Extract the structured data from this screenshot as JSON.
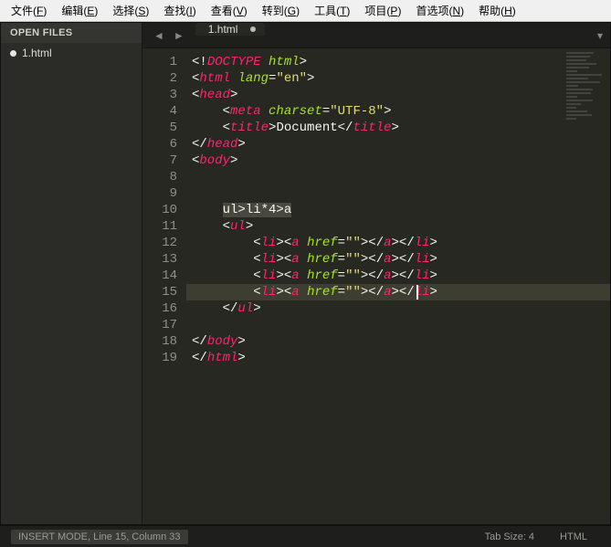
{
  "menubar": {
    "items": [
      {
        "label": "文件",
        "key": "F"
      },
      {
        "label": "编辑",
        "key": "E"
      },
      {
        "label": "选择",
        "key": "S"
      },
      {
        "label": "查找",
        "key": "I"
      },
      {
        "label": "查看",
        "key": "V"
      },
      {
        "label": "转到",
        "key": "G"
      },
      {
        "label": "工具",
        "key": "T"
      },
      {
        "label": "项目",
        "key": "P"
      },
      {
        "label": "首选项",
        "key": "N"
      },
      {
        "label": "帮助",
        "key": "H"
      }
    ]
  },
  "sidebar": {
    "header": "OPEN FILES",
    "files": [
      {
        "name": "1.html",
        "dirty": true
      }
    ]
  },
  "tabs": {
    "prev": "◄",
    "next": "►",
    "dropdown": "▾",
    "items": [
      {
        "label": "1.html",
        "dirty": true
      }
    ]
  },
  "editor": {
    "highlight_line": 15,
    "cursor": {
      "line": 15,
      "column": 33
    },
    "lines": [
      {
        "n": 1,
        "segs": [
          {
            "c": "punct",
            "t": "<!"
          },
          {
            "c": "tag",
            "t": "DOCTYPE"
          },
          {
            "c": "text",
            "t": " "
          },
          {
            "c": "attr",
            "t": "html"
          },
          {
            "c": "punct",
            "t": ">"
          }
        ],
        "indent": 0
      },
      {
        "n": 2,
        "segs": [
          {
            "c": "punct",
            "t": "<"
          },
          {
            "c": "tag",
            "t": "html"
          },
          {
            "c": "text",
            "t": " "
          },
          {
            "c": "attr",
            "t": "lang"
          },
          {
            "c": "punct",
            "t": "="
          },
          {
            "c": "str",
            "t": "\"en\""
          },
          {
            "c": "punct",
            "t": ">"
          }
        ],
        "indent": 0
      },
      {
        "n": 3,
        "segs": [
          {
            "c": "punct",
            "t": "<"
          },
          {
            "c": "tag",
            "t": "head"
          },
          {
            "c": "punct",
            "t": ">"
          }
        ],
        "indent": 0
      },
      {
        "n": 4,
        "segs": [
          {
            "c": "punct",
            "t": "<"
          },
          {
            "c": "tag",
            "t": "meta"
          },
          {
            "c": "text",
            "t": " "
          },
          {
            "c": "attr",
            "t": "charset"
          },
          {
            "c": "punct",
            "t": "="
          },
          {
            "c": "str",
            "t": "\"UTF-8\""
          },
          {
            "c": "punct",
            "t": ">"
          }
        ],
        "indent": 1
      },
      {
        "n": 5,
        "segs": [
          {
            "c": "punct",
            "t": "<"
          },
          {
            "c": "tag",
            "t": "title"
          },
          {
            "c": "punct",
            "t": ">"
          },
          {
            "c": "text",
            "t": "Document"
          },
          {
            "c": "punct",
            "t": "</"
          },
          {
            "c": "tag",
            "t": "title"
          },
          {
            "c": "punct",
            "t": ">"
          }
        ],
        "indent": 1
      },
      {
        "n": 6,
        "segs": [
          {
            "c": "punct",
            "t": "</"
          },
          {
            "c": "tag",
            "t": "head"
          },
          {
            "c": "punct",
            "t": ">"
          }
        ],
        "indent": 0
      },
      {
        "n": 7,
        "segs": [
          {
            "c": "punct",
            "t": "<"
          },
          {
            "c": "tag",
            "t": "body"
          },
          {
            "c": "punct",
            "t": ">"
          }
        ],
        "indent": 0
      },
      {
        "n": 8,
        "segs": [],
        "indent": 0
      },
      {
        "n": 9,
        "segs": [],
        "indent": 0
      },
      {
        "n": 10,
        "segs": [
          {
            "c": "sel",
            "t": "ul>li*4>a"
          }
        ],
        "indent": 1
      },
      {
        "n": 11,
        "segs": [
          {
            "c": "punct",
            "t": "<"
          },
          {
            "c": "tag",
            "t": "ul"
          },
          {
            "c": "punct",
            "t": ">"
          }
        ],
        "indent": 1
      },
      {
        "n": 12,
        "segs": [
          {
            "c": "punct",
            "t": "<"
          },
          {
            "c": "tag",
            "t": "li"
          },
          {
            "c": "punct",
            "t": "><"
          },
          {
            "c": "tag",
            "t": "a"
          },
          {
            "c": "text",
            "t": " "
          },
          {
            "c": "attr",
            "t": "href"
          },
          {
            "c": "punct",
            "t": "="
          },
          {
            "c": "str",
            "t": "\"\""
          },
          {
            "c": "punct",
            "t": "></"
          },
          {
            "c": "tag",
            "t": "a"
          },
          {
            "c": "punct",
            "t": "></"
          },
          {
            "c": "tag",
            "t": "li"
          },
          {
            "c": "punct",
            "t": ">"
          }
        ],
        "indent": 2
      },
      {
        "n": 13,
        "segs": [
          {
            "c": "punct",
            "t": "<"
          },
          {
            "c": "tag",
            "t": "li"
          },
          {
            "c": "punct",
            "t": "><"
          },
          {
            "c": "tag",
            "t": "a"
          },
          {
            "c": "text",
            "t": " "
          },
          {
            "c": "attr",
            "t": "href"
          },
          {
            "c": "punct",
            "t": "="
          },
          {
            "c": "str",
            "t": "\"\""
          },
          {
            "c": "punct",
            "t": "></"
          },
          {
            "c": "tag",
            "t": "a"
          },
          {
            "c": "punct",
            "t": "></"
          },
          {
            "c": "tag",
            "t": "li"
          },
          {
            "c": "punct",
            "t": ">"
          }
        ],
        "indent": 2
      },
      {
        "n": 14,
        "segs": [
          {
            "c": "punct",
            "t": "<"
          },
          {
            "c": "tag",
            "t": "li"
          },
          {
            "c": "punct",
            "t": "><"
          },
          {
            "c": "tag",
            "t": "a"
          },
          {
            "c": "text",
            "t": " "
          },
          {
            "c": "attr",
            "t": "href"
          },
          {
            "c": "punct",
            "t": "="
          },
          {
            "c": "str",
            "t": "\"\""
          },
          {
            "c": "punct",
            "t": "></"
          },
          {
            "c": "tag",
            "t": "a"
          },
          {
            "c": "punct",
            "t": "></"
          },
          {
            "c": "tag",
            "t": "li"
          },
          {
            "c": "punct",
            "t": ">"
          }
        ],
        "indent": 2
      },
      {
        "n": 15,
        "segs": [
          {
            "c": "punct",
            "t": "<"
          },
          {
            "c": "tag",
            "t": "li"
          },
          {
            "c": "punct",
            "t": "><"
          },
          {
            "c": "tag",
            "t": "a"
          },
          {
            "c": "text",
            "t": " "
          },
          {
            "c": "attr",
            "t": "href"
          },
          {
            "c": "punct",
            "t": "="
          },
          {
            "c": "str",
            "t": "\"\""
          },
          {
            "c": "punct",
            "t": "></"
          },
          {
            "c": "tag",
            "t": "a"
          },
          {
            "c": "punct",
            "t": "></"
          },
          {
            "c": "tag",
            "t": "li"
          },
          {
            "c": "punct",
            "t": ">"
          }
        ],
        "indent": 2
      },
      {
        "n": 16,
        "segs": [
          {
            "c": "punct",
            "t": "</"
          },
          {
            "c": "tag",
            "t": "ul"
          },
          {
            "c": "punct",
            "t": ">"
          }
        ],
        "indent": 1
      },
      {
        "n": 17,
        "segs": [],
        "indent": 0
      },
      {
        "n": 18,
        "segs": [
          {
            "c": "punct",
            "t": "</"
          },
          {
            "c": "tag",
            "t": "body"
          },
          {
            "c": "punct",
            "t": ">"
          }
        ],
        "indent": 0
      },
      {
        "n": 19,
        "segs": [
          {
            "c": "punct",
            "t": "</"
          },
          {
            "c": "tag",
            "t": "html"
          },
          {
            "c": "punct",
            "t": ">"
          }
        ],
        "indent": 0
      }
    ]
  },
  "status": {
    "mode": "INSERT MODE, Line 15, Column 33",
    "tab": "Tab Size: 4",
    "lang": "HTML"
  }
}
